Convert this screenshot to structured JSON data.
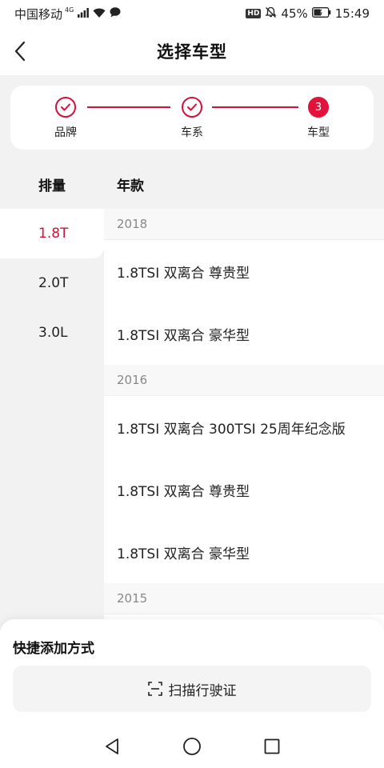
{
  "status_bar": {
    "carrier": "中国移动",
    "network": "4G",
    "hd": "HD",
    "battery": "45%",
    "time": "15:49",
    "icons": [
      "signal-icon",
      "wifi-icon",
      "chat-icon",
      "mute-bell-icon",
      "battery-icon"
    ]
  },
  "header": {
    "title": "选择车型",
    "back_icon": "chevron-left-icon"
  },
  "steps": [
    {
      "label": "品牌",
      "state": "done"
    },
    {
      "label": "车系",
      "state": "done"
    },
    {
      "label": "车型",
      "state": "active",
      "number": "3"
    }
  ],
  "accent_color": "#d2123a",
  "columns": {
    "displacement_header": "排量",
    "year_header": "年款"
  },
  "displacements": [
    "1.8T",
    "2.0T",
    "3.0L"
  ],
  "selected_displacement": "1.8T",
  "model_groups": [
    {
      "year": "2018",
      "models": [
        "1.8TSI 双离合 尊贵型",
        "1.8TSI 双离合 豪华型"
      ]
    },
    {
      "year": "2016",
      "models": [
        "1.8TSI 双离合 300TSI 25周年纪念版",
        "1.8TSI 双离合 尊贵型",
        "1.8TSI 双离合 豪华型"
      ]
    },
    {
      "year": "2015",
      "models": []
    }
  ],
  "quick_add": {
    "title": "快捷添加方式",
    "scan_label": "扫描行驶证",
    "scan_icon": "scan-icon"
  },
  "nav_bar": {
    "icons": [
      "back-triangle-icon",
      "home-circle-icon",
      "recents-square-icon"
    ]
  }
}
